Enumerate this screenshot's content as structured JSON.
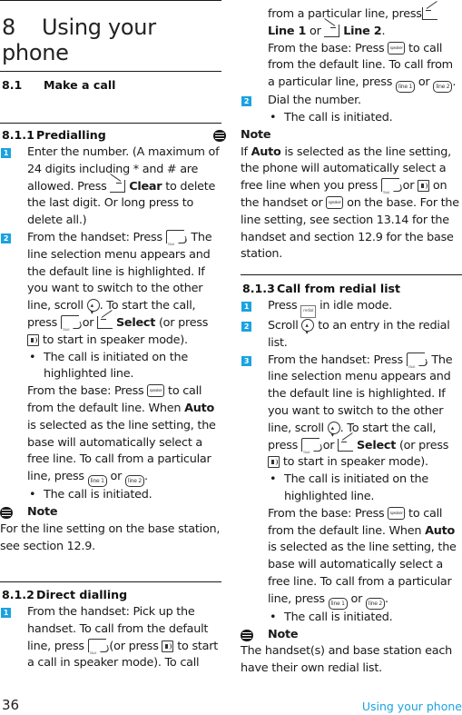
{
  "chapter": {
    "number": "8",
    "title": "Using your phone"
  },
  "section": {
    "number": "8.1",
    "title": "Make a call"
  },
  "subsections": [
    {
      "number": "8.1.1",
      "title": "Predialling"
    },
    {
      "number": "8.1.2",
      "title": "Direct dialling"
    },
    {
      "number": "8.1.3",
      "title": "Call from redial list"
    }
  ],
  "icons": {
    "talk": "talk-key",
    "soft_left": "left-soft-key",
    "soft_right": "right-soft-key",
    "speaker_handset": "speaker-key",
    "speaker_base_label": "speaker",
    "line1_label": "line 1",
    "line2_label": "line 2",
    "redial_label": "redial",
    "nav": "navigation-key"
  },
  "predialling": {
    "step1_num": "1",
    "step1_a": "Enter the number. (A maximum of 24 digits including * and # are allowed. Press ",
    "step1_b": "Clear",
    "step1_c": " to delete the last digit. Or long press to delete all.)",
    "step2_num": "2",
    "step2_a": "From the handset: Press ",
    "step2_b": ". The line selection menu appears and the default line is highlighted. If you want to switch to the other line, scroll ",
    "step2_c": ". To start the call, press ",
    "step2_or": " or ",
    "step2_select": "Select",
    "step2_d": " (or press ",
    "step2_e": " to start in speaker mode).",
    "bullet1": "The call is initiated on the highlighted line.",
    "base_a": "From the base: Press ",
    "base_b": " to call from the default line. When ",
    "base_auto": "Auto",
    "base_c": " is selected as the line setting, the base will automatically select a free line. To call from a particular line, press ",
    "base_or": " or ",
    "base_end": ".",
    "bullet2": "The call is initiated.",
    "note_title": "Note",
    "note_text": "For the line setting on the base station, see section 12.9."
  },
  "direct": {
    "step1_num": "1",
    "step1_a": "From the handset: Pick up the handset. To call from the default line, press ",
    "step1_b": " (or press ",
    "step1_c": " to start a call in speaker mode). To call from a particular line, press ",
    "line1": "Line 1",
    "or": " or ",
    "line2": "Line 2",
    "end": ".",
    "base_a": "From the base: Press ",
    "base_b": " to call from the default line. To call from a particular line, press ",
    "base_end": ".",
    "step2_num": "2",
    "step2": "Dial the number.",
    "bullet": "The call is initiated.",
    "note_title": "Note",
    "note_a": "If ",
    "note_auto": "Auto",
    "note_b": " is selected as the line setting, the phone will automatically select a free line when you press ",
    "note_or": " or ",
    "note_c": " on the handset or ",
    "note_d": " on the base. For the line setting, see section 13.14 for the handset and section 12.9 for the base station."
  },
  "redial": {
    "step1_num": "1",
    "step1_a": "Press ",
    "step1_b": " in idle mode.",
    "step2_num": "2",
    "step2_a": "Scroll ",
    "step2_b": " to an entry in the redial list.",
    "step3_num": "3",
    "step3_a": "From the handset: Press ",
    "step3_b": ". The line selection menu appears and the default line is highlighted. If you want to switch to the other line, scroll ",
    "step3_c": ". To start the call, press ",
    "step3_or": " or ",
    "step3_select": "Select",
    "step3_d": " (or press ",
    "step3_e": " to start in speaker mode).",
    "bullet1": "The call is initiated on the highlighted line.",
    "base_a": "From the base: Press ",
    "base_b": " to call from the default line. When ",
    "base_auto": "Auto",
    "base_c": " is selected as the line setting, the base will automatically select a free line. To call from a particular line, press ",
    "base_or": " or ",
    "base_end": ".",
    "bullet2": "The call is initiated.",
    "note_title": "Note",
    "note_text": "The handset(s) and base station each have their own redial list."
  },
  "footer": {
    "page_number": "36",
    "chapter_title": "Using your phone"
  },
  "colors": {
    "accent": "#1aa3e0",
    "text": "#1a1a1a"
  }
}
